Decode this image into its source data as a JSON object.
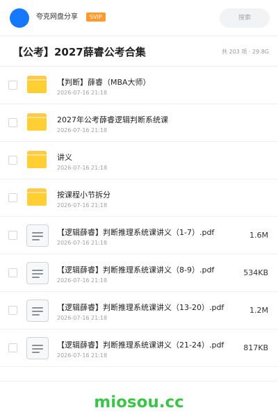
{
  "header": {
    "share_name": "夸克网盘分享",
    "badge": "SVIP",
    "search_placeholder": "搜索",
    "accent_color": "#1677ff",
    "badge_color": "#ff9a2e"
  },
  "folder": {
    "title": "【公考】2027薛睿公考合集",
    "meta": "共 203 项 · 29.8G"
  },
  "files": [
    {
      "type": "folder",
      "name": "【判断】薛睿（MBA大师）",
      "date": "2026-07-16 21:18",
      "size": ""
    },
    {
      "type": "folder",
      "name": "2027年公考薛睿逻辑判断系统课",
      "date": "2026-07-16 21:18",
      "size": ""
    },
    {
      "type": "folder",
      "name": "讲义",
      "date": "2026-07-16 21:18",
      "size": ""
    },
    {
      "type": "folder",
      "name": "按课程小节拆分",
      "date": "2026-07-16 21:18",
      "size": ""
    },
    {
      "type": "file",
      "name": "【逻辑薛睿】判断推理系统课讲义（1-7）.pdf",
      "date": "2026-07-16 21:18",
      "size": "1.6M"
    },
    {
      "type": "file",
      "name": "【逻辑薛睿】判断推理系统课讲义（8-9）.pdf",
      "date": "2026-07-16 21:18",
      "size": "534KB"
    },
    {
      "type": "file",
      "name": "【逻辑薛睿】判断推理系统课讲义（13-20）.pdf",
      "date": "2026-07-16 21:18",
      "size": "1.2M"
    },
    {
      "type": "file",
      "name": "【逻辑薛睿】判断推理系统课讲义（21-24）.pdf",
      "date": "2026-07-16 21:18",
      "size": "817KB"
    }
  ],
  "icons": {
    "folder": "folder-icon",
    "file": "document-icon"
  },
  "watermark": {
    "text": "miosou.cc",
    "color": "#3cc448"
  }
}
